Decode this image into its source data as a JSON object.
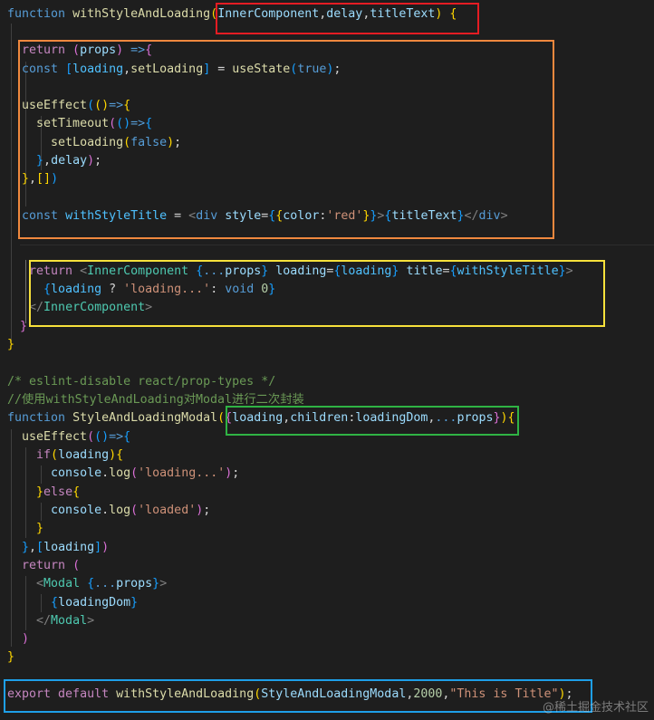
{
  "editor": {
    "theme_colors": {
      "background": "#1e1e1e",
      "keyword": "#569cd6",
      "control": "#c586c0",
      "function": "#dcdcaa",
      "variable": "#9cdcfe",
      "string": "#ce9178",
      "number": "#b5cea8",
      "comment": "#6a9955",
      "component": "#4ec9b0",
      "bracket_1": "#ffd700",
      "bracket_2": "#da70d6",
      "bracket_3": "#179fff"
    },
    "highlight_boxes": [
      {
        "name": "params-box",
        "color": "#e51c23"
      },
      {
        "name": "hooks-box",
        "color": "#f0883e"
      },
      {
        "name": "return-box",
        "color": "#f7e13b"
      },
      {
        "name": "props-box",
        "color": "#2fb344"
      },
      {
        "name": "export-box",
        "color": "#1e9fe8"
      }
    ],
    "lines": [
      {
        "i": 0,
        "tokens": [
          [
            "kw",
            "function "
          ],
          [
            "fn",
            "withStyleAndLoading"
          ],
          [
            "b1",
            "("
          ],
          [
            "var",
            "InnerComponent"
          ],
          [
            "",
            ","
          ],
          [
            "var",
            "delay"
          ],
          [
            "",
            ","
          ],
          [
            "var",
            "titleText"
          ],
          [
            "b1",
            ")"
          ],
          [
            "",
            " "
          ],
          [
            "b1",
            "{"
          ]
        ]
      },
      {
        "i": 1,
        "tokens": []
      },
      {
        "i": 2,
        "tokens": [
          [
            "",
            ""
          ],
          [
            "ctl",
            "return "
          ],
          [
            "b2",
            "("
          ],
          [
            "var",
            "props"
          ],
          [
            "b2",
            ")"
          ],
          [
            "",
            " "
          ],
          [
            "kw",
            "=>"
          ],
          [
            "b2",
            "{"
          ]
        ]
      },
      {
        "i": 3,
        "tokens": [
          [
            "",
            "  "
          ],
          [
            "kw",
            "const "
          ],
          [
            "b3",
            "["
          ],
          [
            "const",
            "loading"
          ],
          [
            "",
            ","
          ],
          [
            "fn",
            "setLoading"
          ],
          [
            "b3",
            "]"
          ],
          [
            "",
            " = "
          ],
          [
            "fn",
            "useState"
          ],
          [
            "b3",
            "("
          ],
          [
            "kw",
            "true"
          ],
          [
            "b3",
            ")"
          ],
          [
            "",
            ";"
          ]
        ]
      },
      {
        "i": 4,
        "tokens": []
      },
      {
        "i": 5,
        "tokens": [
          [
            "",
            "  "
          ],
          [
            "fn",
            "useEffect"
          ],
          [
            "b3",
            "("
          ],
          [
            "b1",
            "()"
          ],
          [
            "kw",
            "=>"
          ],
          [
            "b1",
            "{"
          ]
        ]
      },
      {
        "i": 6,
        "tokens": [
          [
            "",
            "    "
          ],
          [
            "fn",
            "setTimeout"
          ],
          [
            "b2",
            "("
          ],
          [
            "b3",
            "()"
          ],
          [
            "kw",
            "=>"
          ],
          [
            "b3",
            "{"
          ]
        ]
      },
      {
        "i": 7,
        "tokens": [
          [
            "",
            "      "
          ],
          [
            "fn",
            "setLoading"
          ],
          [
            "b1",
            "("
          ],
          [
            "kw",
            "false"
          ],
          [
            "b1",
            ")"
          ],
          [
            "",
            ";"
          ]
        ]
      },
      {
        "i": 8,
        "tokens": [
          [
            "",
            "    "
          ],
          [
            "b3",
            "}"
          ],
          [
            "",
            ","
          ],
          [
            "var",
            "delay"
          ],
          [
            "b2",
            ")"
          ],
          [
            "",
            ";"
          ]
        ]
      },
      {
        "i": 9,
        "tokens": [
          [
            "",
            "  "
          ],
          [
            "b1",
            "}"
          ],
          [
            "",
            ","
          ],
          [
            "b1",
            "[]"
          ],
          [
            "b3",
            ")"
          ]
        ]
      },
      {
        "i": 10,
        "tokens": []
      },
      {
        "i": 11,
        "tokens": [
          [
            "",
            "  "
          ],
          [
            "kw",
            "const "
          ],
          [
            "const",
            "withStyleTitle"
          ],
          [
            "",
            " = "
          ],
          [
            "brk",
            "<"
          ],
          [
            "kw",
            "div "
          ],
          [
            "var",
            "style"
          ],
          [
            "",
            "="
          ],
          [
            "b3",
            "{"
          ],
          [
            "b1",
            "{"
          ],
          [
            "var",
            "color"
          ],
          [
            "",
            ":"
          ],
          [
            "str",
            "'red'"
          ],
          [
            "b1",
            "}"
          ],
          [
            "b3",
            "}"
          ],
          [
            "brk",
            ">"
          ],
          [
            "b3",
            "{"
          ],
          [
            "var",
            "titleText"
          ],
          [
            "b3",
            "}"
          ],
          [
            "brk",
            "</"
          ],
          [
            "kw",
            "div"
          ],
          [
            "brk",
            ">"
          ]
        ]
      },
      {
        "i": 12,
        "tokens": []
      },
      {
        "i": 13,
        "tokens": []
      },
      {
        "i": 14,
        "tokens": [
          [
            "",
            "   "
          ],
          [
            "ctl",
            "return "
          ],
          [
            "brk",
            "<"
          ],
          [
            "tag",
            "InnerComponent "
          ],
          [
            "b3",
            "{"
          ],
          [
            "kw",
            "..."
          ],
          [
            "var",
            "props"
          ],
          [
            "b3",
            "}"
          ],
          [
            "",
            " "
          ],
          [
            "var",
            "loading"
          ],
          [
            "",
            "="
          ],
          [
            "b3",
            "{"
          ],
          [
            "const",
            "loading"
          ],
          [
            "b3",
            "}"
          ],
          [
            "",
            " "
          ],
          [
            "var",
            "title"
          ],
          [
            "",
            "="
          ],
          [
            "b3",
            "{"
          ],
          [
            "const",
            "withStyleTitle"
          ],
          [
            "b3",
            "}"
          ],
          [
            "brk",
            ">"
          ]
        ]
      },
      {
        "i": 15,
        "tokens": [
          [
            "",
            "     "
          ],
          [
            "b3",
            "{"
          ],
          [
            "const",
            "loading"
          ],
          [
            "",
            " ? "
          ],
          [
            "str",
            "'loading...'"
          ],
          [
            "",
            ": "
          ],
          [
            "kw",
            "void "
          ],
          [
            "num",
            "0"
          ],
          [
            "b3",
            "}"
          ]
        ]
      },
      {
        "i": 16,
        "tokens": [
          [
            "",
            "   "
          ],
          [
            "brk",
            "</"
          ],
          [
            "tag",
            "InnerComponent"
          ],
          [
            "brk",
            ">"
          ]
        ]
      },
      {
        "i": 17,
        "tokens": [
          [
            "",
            ""
          ],
          [
            "b2",
            "}"
          ]
        ]
      },
      {
        "i": 18,
        "tokens": [
          [
            "b1",
            "}"
          ]
        ]
      },
      {
        "i": 19,
        "tokens": []
      },
      {
        "i": 20,
        "tokens": [
          [
            "cmt",
            "/* eslint-disable react/prop-types */"
          ]
        ]
      },
      {
        "i": 21,
        "tokens": [
          [
            "cmt",
            "//使用withStyleAndLoading对Modal进行二次封装"
          ]
        ]
      },
      {
        "i": 22,
        "tokens": [
          [
            "kw",
            "function "
          ],
          [
            "fn",
            "StyleAndLoadingModal"
          ],
          [
            "b1",
            "("
          ],
          [
            "b2",
            "{"
          ],
          [
            "var",
            "loading"
          ],
          [
            "",
            ","
          ],
          [
            "var",
            "children"
          ],
          [
            "",
            ":"
          ],
          [
            "var",
            "loadingDom"
          ],
          [
            "",
            ","
          ],
          [
            "kw",
            "..."
          ],
          [
            "var",
            "props"
          ],
          [
            "b2",
            "}"
          ],
          [
            "b1",
            ")"
          ],
          [
            "b1",
            "{"
          ]
        ]
      },
      {
        "i": 23,
        "tokens": [
          [
            "",
            "  "
          ],
          [
            "fn",
            "useEffect"
          ],
          [
            "b2",
            "("
          ],
          [
            "b3",
            "()"
          ],
          [
            "kw",
            "=>"
          ],
          [
            "b3",
            "{"
          ]
        ]
      },
      {
        "i": 24,
        "tokens": [
          [
            "",
            "    "
          ],
          [
            "ctl",
            "if"
          ],
          [
            "b1",
            "("
          ],
          [
            "var",
            "loading"
          ],
          [
            "b1",
            ")"
          ],
          [
            "b1",
            "{"
          ]
        ]
      },
      {
        "i": 25,
        "tokens": [
          [
            "",
            "      "
          ],
          [
            "var",
            "console"
          ],
          [
            "",
            "."
          ],
          [
            "fn",
            "log"
          ],
          [
            "b2",
            "("
          ],
          [
            "str",
            "'loading...'"
          ],
          [
            "b2",
            ")"
          ],
          [
            "",
            ";"
          ]
        ]
      },
      {
        "i": 26,
        "tokens": [
          [
            "",
            "    "
          ],
          [
            "b1",
            "}"
          ],
          [
            "ctl",
            "else"
          ],
          [
            "b1",
            "{"
          ]
        ]
      },
      {
        "i": 27,
        "tokens": [
          [
            "",
            "      "
          ],
          [
            "var",
            "console"
          ],
          [
            "",
            "."
          ],
          [
            "fn",
            "log"
          ],
          [
            "b2",
            "("
          ],
          [
            "str",
            "'loaded'"
          ],
          [
            "b2",
            ")"
          ],
          [
            "",
            ";"
          ]
        ]
      },
      {
        "i": 28,
        "tokens": [
          [
            "",
            "    "
          ],
          [
            "b1",
            "}"
          ]
        ]
      },
      {
        "i": 29,
        "tokens": [
          [
            "",
            "  "
          ],
          [
            "b3",
            "}"
          ],
          [
            "",
            ","
          ],
          [
            "b3",
            "["
          ],
          [
            "var",
            "loading"
          ],
          [
            "b3",
            "]"
          ],
          [
            "b2",
            ")"
          ]
        ]
      },
      {
        "i": 30,
        "tokens": [
          [
            "",
            "  "
          ],
          [
            "ctl",
            "return "
          ],
          [
            "b2",
            "("
          ]
        ]
      },
      {
        "i": 31,
        "tokens": [
          [
            "",
            "    "
          ],
          [
            "brk",
            "<"
          ],
          [
            "tag",
            "Modal "
          ],
          [
            "b3",
            "{"
          ],
          [
            "kw",
            "..."
          ],
          [
            "var",
            "props"
          ],
          [
            "b3",
            "}"
          ],
          [
            "brk",
            ">"
          ]
        ]
      },
      {
        "i": 32,
        "tokens": [
          [
            "",
            "      "
          ],
          [
            "b3",
            "{"
          ],
          [
            "var",
            "loadingDom"
          ],
          [
            "b3",
            "}"
          ]
        ]
      },
      {
        "i": 33,
        "tokens": [
          [
            "",
            "    "
          ],
          [
            "brk",
            "</"
          ],
          [
            "tag",
            "Modal"
          ],
          [
            "brk",
            ">"
          ]
        ]
      },
      {
        "i": 34,
        "tokens": [
          [
            "",
            "  "
          ],
          [
            "b2",
            ")"
          ]
        ]
      },
      {
        "i": 35,
        "tokens": [
          [
            "b1",
            "}"
          ]
        ]
      },
      {
        "i": 36,
        "tokens": []
      },
      {
        "i": 37,
        "tokens": [
          [
            "ctl",
            "export "
          ],
          [
            "ctl",
            "default "
          ],
          [
            "fn",
            "withStyleAndLoading"
          ],
          [
            "b1",
            "("
          ],
          [
            "var",
            "StyleAndLoadingModal"
          ],
          [
            "",
            ","
          ],
          [
            "num",
            "2000"
          ],
          [
            "",
            ","
          ],
          [
            "str",
            "\"This is Title\""
          ],
          [
            "b1",
            ")"
          ],
          [
            "",
            ";"
          ]
        ]
      }
    ]
  },
  "watermark": {
    "text": "@稀土掘金技术社区"
  }
}
